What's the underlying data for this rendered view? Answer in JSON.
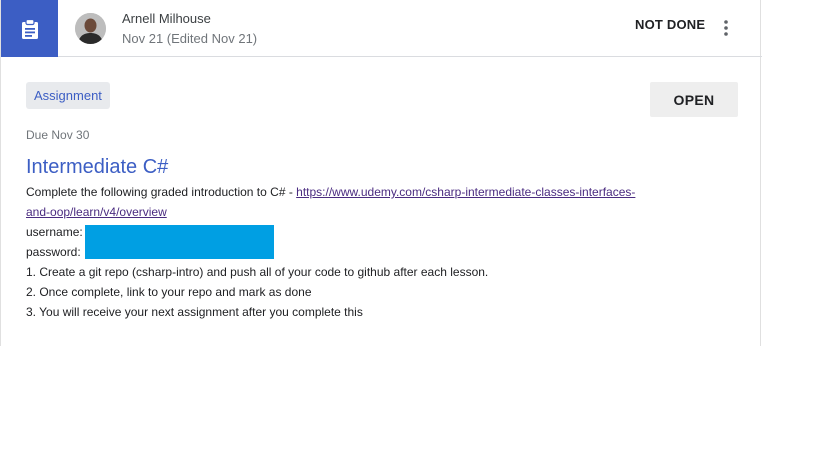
{
  "header": {
    "author_name": "Arnell Milhouse",
    "date_line": "Nov 21 (Edited Nov 21)",
    "status": "NOT DONE",
    "type_icon": "assignment-clipboard-icon",
    "menu_icon": "more-vert-icon"
  },
  "assignment": {
    "chip_label": "Assignment",
    "open_label": "OPEN",
    "due": "Due Nov 30",
    "title": "Intermediate C#",
    "intro_text": "Complete the following graded introduction to C# - ",
    "link_text": "https://www.udemy.com/csharp-intermediate-classes-interfaces-and-oop/learn/v4/overview",
    "username_label": "username:",
    "password_label": "password:",
    "steps": [
      "1. Create a git repo (csharp-intro) and push all of your code to github after each lesson.",
      "2. Once complete, link to your repo and mark as done",
      "3. You will receive your next assignment after you complete this"
    ]
  },
  "colors": {
    "accent": "#3c5ec4",
    "redaction": "#009fe3",
    "link_visited": "#4a2b80"
  }
}
